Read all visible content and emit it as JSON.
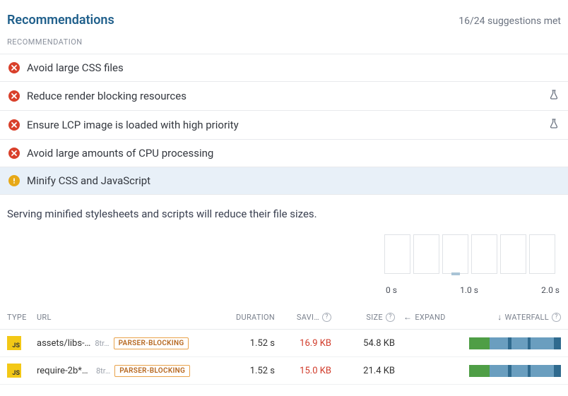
{
  "header": {
    "title": "Recommendations",
    "summary": "16/24 suggestions met"
  },
  "sectionLabel": "RECOMMENDATION",
  "recs": [
    {
      "status": "fail",
      "text": "Avoid large CSS files",
      "flask": false
    },
    {
      "status": "fail",
      "text": "Reduce render blocking resources",
      "flask": true
    },
    {
      "status": "fail",
      "text": "Ensure LCP image is loaded with high priority",
      "flask": true
    },
    {
      "status": "fail",
      "text": "Avoid large amounts of CPU processing",
      "flask": false
    },
    {
      "status": "warn",
      "text": "Minify CSS and JavaScript",
      "flask": false,
      "selected": true
    }
  ],
  "description": "Serving minified stylesheets and scripts will reduce their file sizes.",
  "axis": {
    "t0": "0 s",
    "t1": "1.0 s",
    "t2": "2.0 s"
  },
  "columns": {
    "type": "TYPE",
    "url": "URL",
    "duration": "DURATION",
    "savings": "SAVI…",
    "size": "SIZE",
    "expand": "EXPAND",
    "waterfall": "WATERFALL"
  },
  "rows": [
    {
      "type": "JS",
      "url": "assets/libs-…",
      "host": "8tr…",
      "badge": "PARSER-BLOCKING",
      "duration": "1.52 s",
      "savings": "16.9 KB",
      "size": "54.8 KB"
    },
    {
      "type": "JS",
      "url": "require-2b**…",
      "host": "8tr…",
      "badge": "PARSER-BLOCKING",
      "duration": "1.52 s",
      "savings": "15.0 KB",
      "size": "21.4 KB"
    }
  ]
}
